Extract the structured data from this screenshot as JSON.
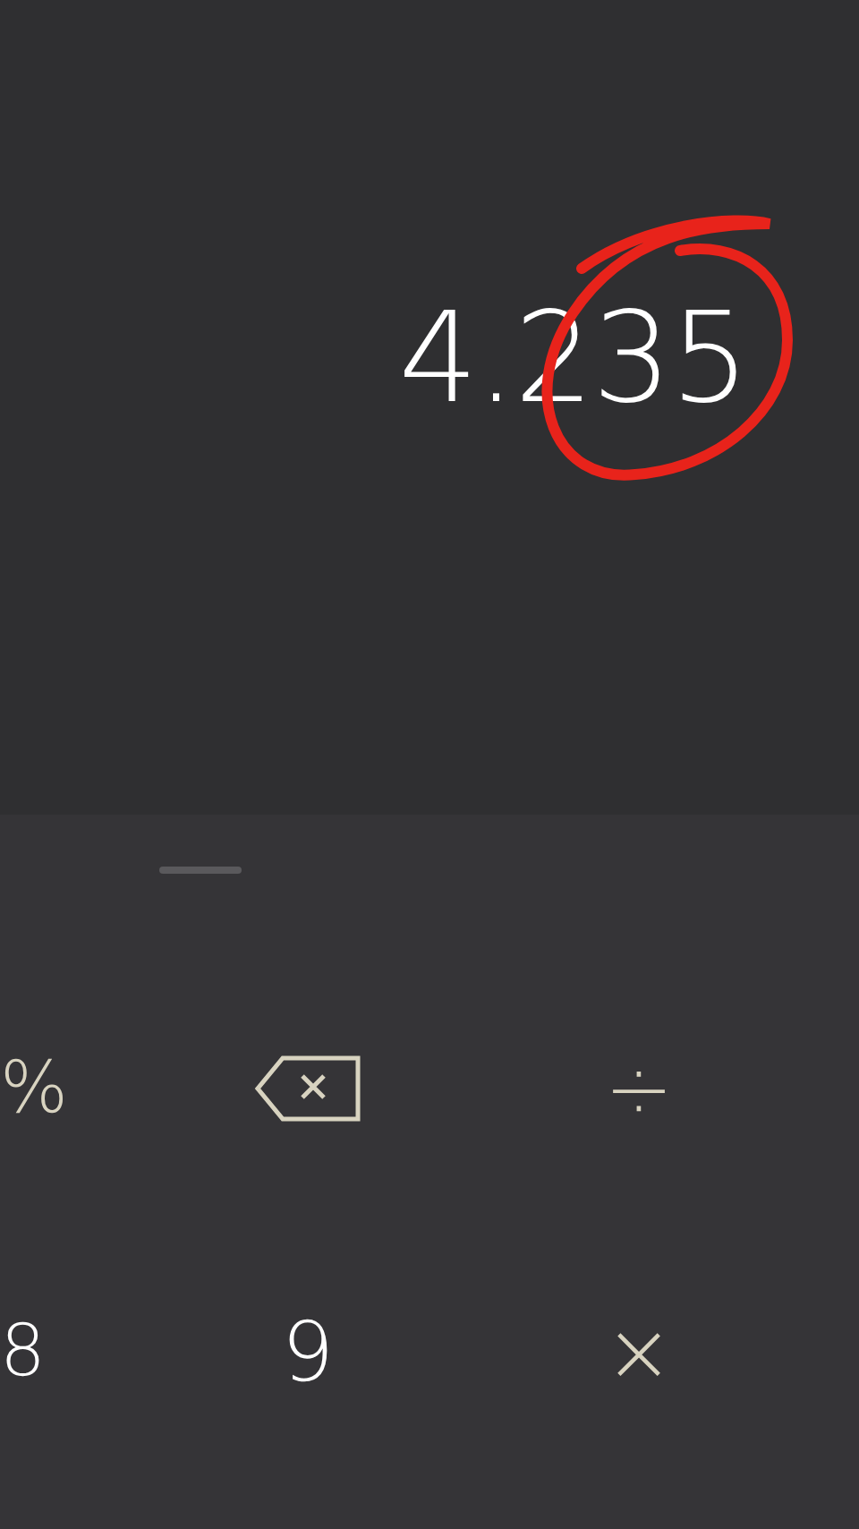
{
  "display": {
    "result": "4.235"
  },
  "annotation": {
    "kind": "circle",
    "color": "#e8231b"
  },
  "keypad": {
    "keys": [
      {
        "kind": "operator",
        "label": "%"
      },
      {
        "kind": "backspace"
      },
      {
        "kind": "operator",
        "label": "÷"
      },
      {
        "kind": "digit",
        "label": "8"
      },
      {
        "kind": "digit",
        "label": "9"
      },
      {
        "kind": "operator",
        "label": "×"
      }
    ]
  }
}
